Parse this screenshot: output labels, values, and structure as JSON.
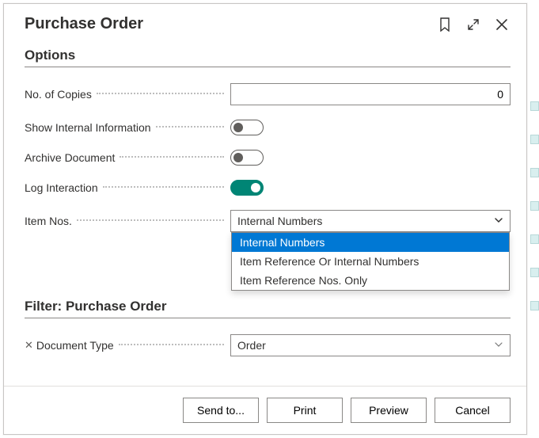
{
  "header": {
    "title": "Purchase Order",
    "icons": {
      "bookmark": "bookmark-icon",
      "expand": "expand-icon",
      "close": "close-icon"
    }
  },
  "sections": {
    "options_title": "Options",
    "filter_title": "Filter: Purchase Order"
  },
  "options": {
    "no_of_copies": {
      "label": "No. of Copies",
      "value": "0"
    },
    "show_internal": {
      "label": "Show Internal Information",
      "on": false
    },
    "archive_doc": {
      "label": "Archive Document",
      "on": false
    },
    "log_interaction": {
      "label": "Log Interaction",
      "on": true
    },
    "item_nos": {
      "label": "Item Nos.",
      "selected": "Internal Numbers",
      "options": [
        "Internal Numbers",
        "Item Reference Or Internal Numbers",
        "Item Reference Nos. Only"
      ]
    }
  },
  "filter": {
    "doc_type": {
      "label": "Document Type",
      "value": "Order"
    }
  },
  "footer": {
    "send_to": "Send to...",
    "print": "Print",
    "preview": "Preview",
    "cancel": "Cancel"
  }
}
